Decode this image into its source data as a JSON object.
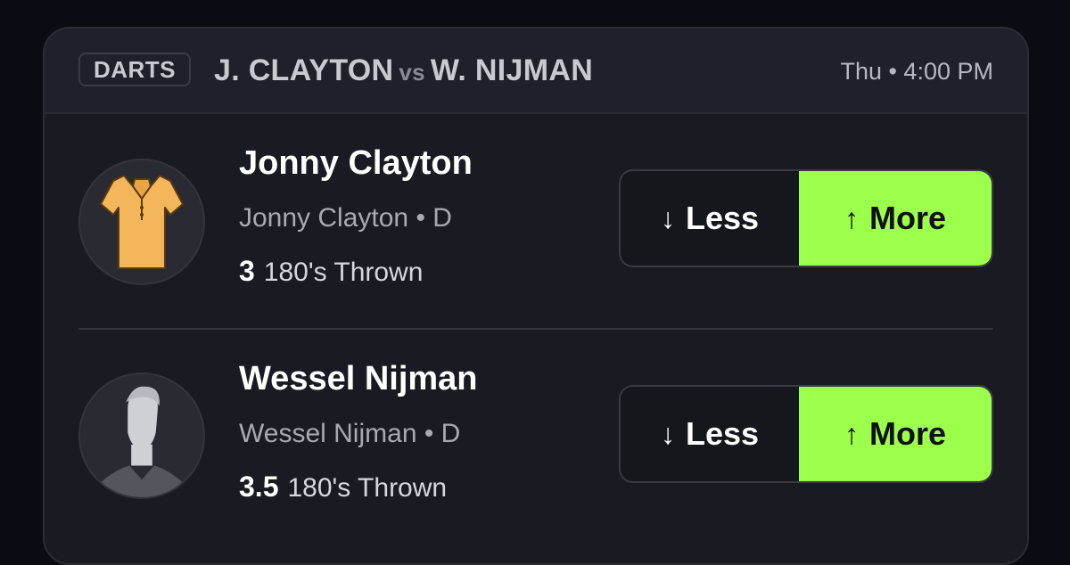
{
  "header": {
    "sport": "DARTS",
    "team_a": "J. CLAYTON",
    "vs": "vs",
    "team_b": "W. NIJMAN",
    "time": "Thu • 4:00 PM"
  },
  "players": [
    {
      "name": "Jonny Clayton",
      "subtitle": "Jonny Clayton • D",
      "line_value": "3",
      "stat": "180's Thrown",
      "avatar": "jersey-icon",
      "less_label": "Less",
      "more_label": "More"
    },
    {
      "name": "Wessel Nijman",
      "subtitle": "Wessel Nijman • D",
      "line_value": "3.5",
      "stat": "180's Thrown",
      "avatar": "silhouette-icon",
      "less_label": "Less",
      "more_label": "More"
    }
  ],
  "colors": {
    "accent": "#9cff4b",
    "card_bg": "#1a1a22",
    "page_bg": "#0b0b13"
  }
}
